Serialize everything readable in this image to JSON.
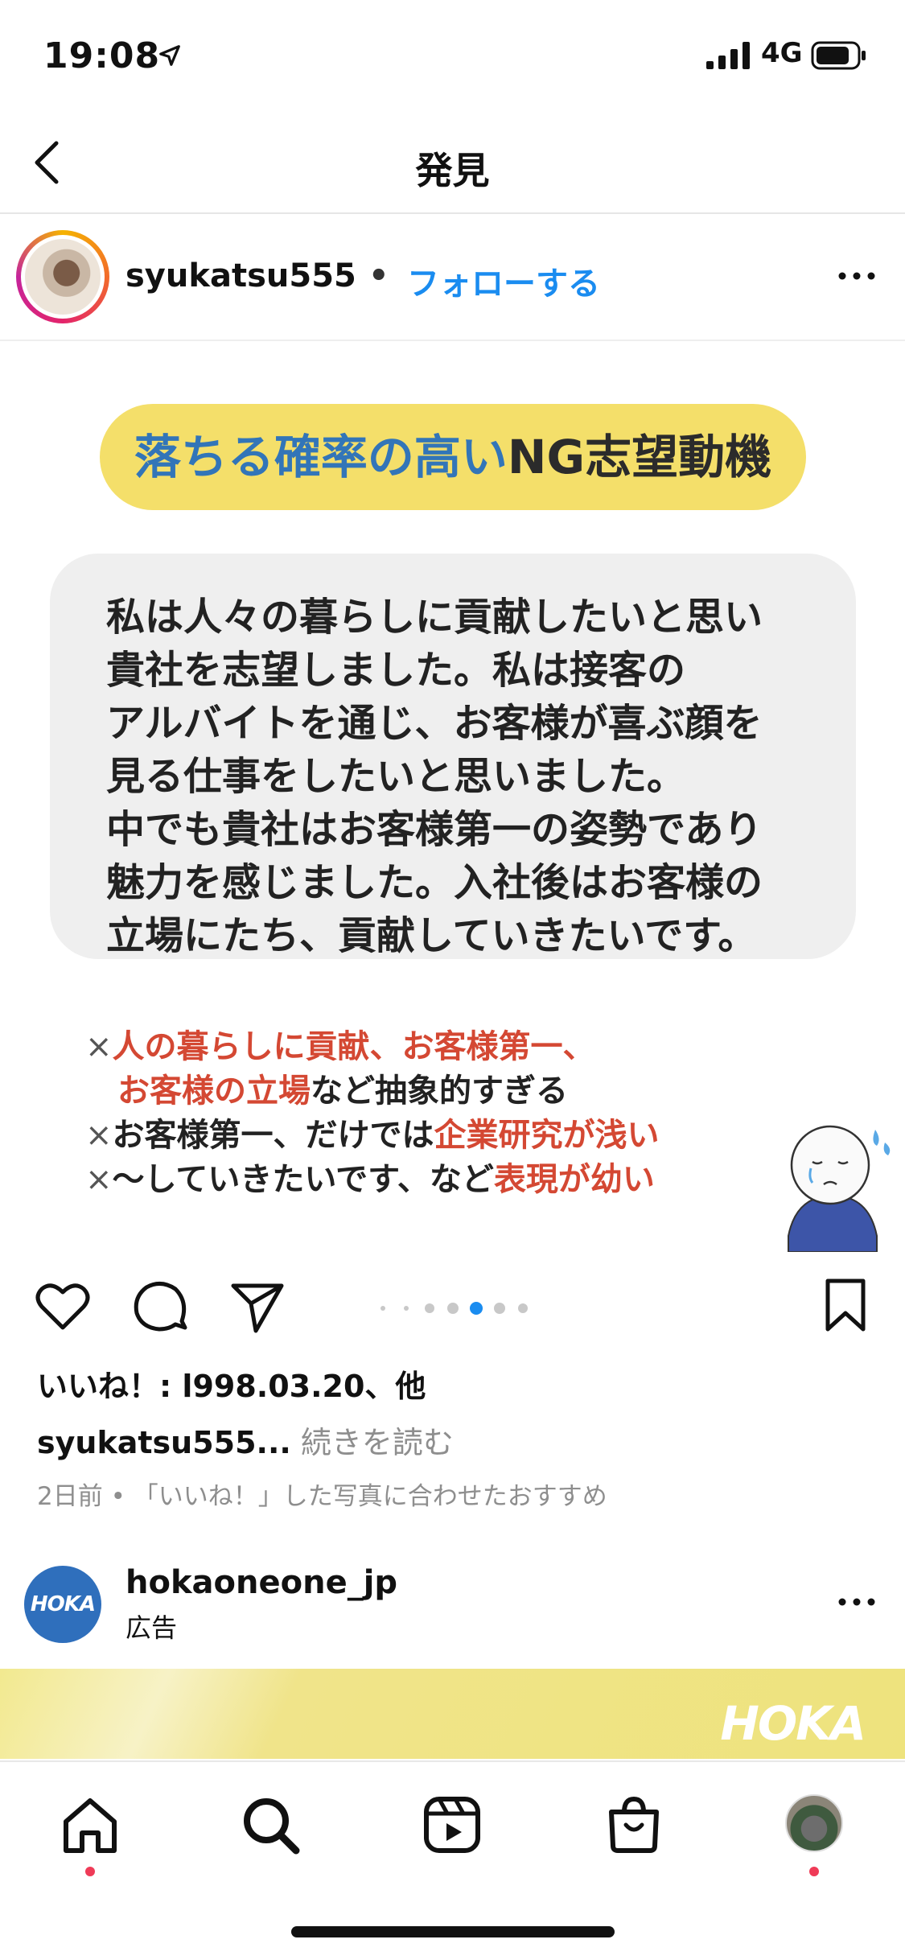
{
  "status_bar": {
    "time": "19:08",
    "network": "4G"
  },
  "nav": {
    "title": "発見"
  },
  "post": {
    "username": "syukatsu555",
    "separator": "•",
    "follow_label": "フォローする",
    "image": {
      "headline_blue": "落ちる確率の高い",
      "headline_dark": "NG志望動機",
      "bubble_text": "私は人々の暮らしに貢献したいと思い\n貴社を志望しました。私は接客の\nアルバイトを通じ、お客様が喜ぶ顔を\n見る仕事をしたいと思いました。\n中でも貴社はお客様第一の姿勢であり\n魅力を感じました。入社後はお客様の\n立場にたち、貢献していきたいです。",
      "note1_mark": "×",
      "note1_red": "人の暮らしに貢献、お客様第一、",
      "note1b_red": "お客様の立場",
      "note1b_dark": "など抽象的すぎる",
      "note2_mark": "×",
      "note2_dark": "お客様第一、だけでは",
      "note2_red": "企業研究が浅い",
      "note3_mark": "×",
      "note3_dark": "〜していきたいです、など",
      "note3_red": "表現が幼い"
    },
    "carousel": {
      "count": 7,
      "active_index": 4
    },
    "likes_text": "いいね！: l998.03.20、他",
    "caption_user": "syukatsu555",
    "caption_ellipsis": "...",
    "caption_more": "続きを読む",
    "meta_text": "2日前 • 「いいね！」した写真に合わせたおすすめ"
  },
  "ad": {
    "avatar_text": "HOKA",
    "username": "hokaoneone_jp",
    "label": "広告",
    "banner_logo": "HOKA"
  },
  "icons": {
    "back": "chevron-left-icon",
    "more": "ellipsis-icon",
    "like": "heart-icon",
    "comment": "comment-icon",
    "share": "paper-plane-icon",
    "save": "bookmark-icon",
    "tabs": [
      "home-icon",
      "search-icon",
      "reels-icon",
      "shop-icon",
      "profile-avatar"
    ]
  },
  "colors": {
    "follow_blue": "#1a8cf0",
    "pill_yellow": "#f4df6a",
    "headline_blue": "#3275b8",
    "note_red": "#d44833",
    "notification_dot": "#ef3b57"
  }
}
